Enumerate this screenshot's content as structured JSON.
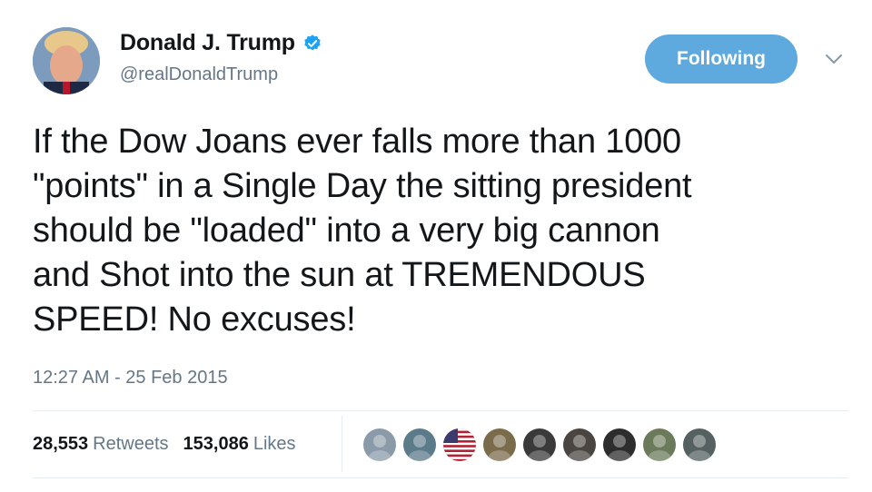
{
  "user": {
    "display_name": "Donald J. Trump",
    "handle": "@realDonaldTrump",
    "verified": true,
    "avatar_icon": "profile-photo"
  },
  "actions": {
    "follow_label": "Following",
    "menu_icon": "chevron-down-icon"
  },
  "tweet": {
    "text": "If the Dow Joans ever falls more than 1000\n\"points\" in a Single Day the sitting president\nshould be \"loaded\" into a very big cannon\nand Shot into the sun at TREMENDOUS\nSPEED! No excuses!",
    "timestamp": "12:27 AM - 25 Feb 2015"
  },
  "stats": {
    "retweets_count": "28,553",
    "retweets_label": "Retweets",
    "likes_count": "153,086",
    "likes_label": "Likes"
  },
  "likers": [
    {
      "name": "liker-avatar-1",
      "color": "#8a9aa8"
    },
    {
      "name": "liker-avatar-2",
      "color": "#5b7a8a"
    },
    {
      "name": "liker-avatar-3",
      "color": "#b22234"
    },
    {
      "name": "liker-avatar-4",
      "color": "#7a6b4a"
    },
    {
      "name": "liker-avatar-5",
      "color": "#3a3a3a"
    },
    {
      "name": "liker-avatar-6",
      "color": "#4a4540"
    },
    {
      "name": "liker-avatar-7",
      "color": "#2d2d2d"
    },
    {
      "name": "liker-avatar-8",
      "color": "#6b7a5a"
    },
    {
      "name": "liker-avatar-9",
      "color": "#556060"
    }
  ],
  "colors": {
    "accent": "#1da1f2",
    "follow_button": "#5ea9dd",
    "muted_text": "#657786",
    "primary_text": "#14171a",
    "divider": "#e6ecf0"
  }
}
